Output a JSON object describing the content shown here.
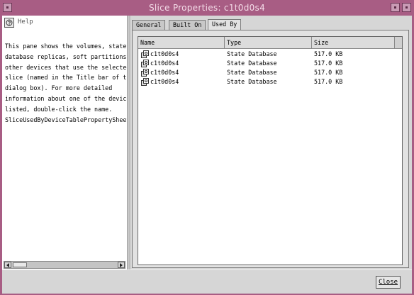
{
  "window": {
    "title": "Slice Properties: c1t0d0s4"
  },
  "help": {
    "label": "Help",
    "lines": [
      "This pane shows the volumes, state",
      "database replicas, soft partitions,",
      "other devices that use the selected",
      "slice (named in the Title bar of thi",
      "dialog box). For more detailed",
      "information about one of the devices",
      "listed, double-click the name.",
      "SliceUsedByDeviceTablePropertySheet."
    ]
  },
  "tabs": [
    {
      "label": "General"
    },
    {
      "label": "Built On"
    },
    {
      "label": "Used By",
      "active": true
    }
  ],
  "table": {
    "columns": [
      "Name",
      "Type",
      "Size"
    ],
    "rows": [
      {
        "name": "c1t0d0s4",
        "type": "State Database",
        "size": "517.0 KB"
      },
      {
        "name": "c1t0d0s4",
        "type": "State Database",
        "size": "517.0 KB"
      },
      {
        "name": "c1t0d0s4",
        "type": "State Database",
        "size": "517.0 KB"
      },
      {
        "name": "c1t0d0s4",
        "type": "State Database",
        "size": "517.0 KB"
      }
    ]
  },
  "buttons": {
    "close": "Close"
  },
  "colors": {
    "titlebar": "#a85d84",
    "title_text": "#f4dce8",
    "panel_bg": "#d6d6d6"
  },
  "icons": {
    "help": "help-book-icon",
    "row": "state-database-icon"
  }
}
